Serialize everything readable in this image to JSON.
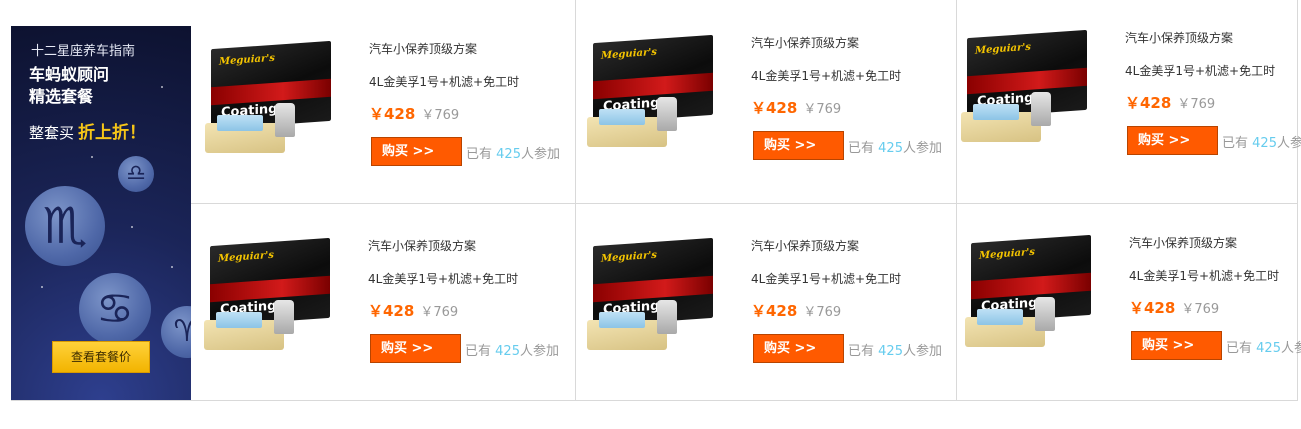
{
  "banner": {
    "subtitle": "十二星座养车指南",
    "title_line1": "车蚂蚁顾问",
    "title_line2": "精选套餐",
    "promo_prefix": "整套买",
    "promo_highlight": "折上折！",
    "button_label": "查看套餐价",
    "zodiac_icons": [
      "libra-icon",
      "scorpio-icon",
      "cancer-icon",
      "aries-icon"
    ]
  },
  "products": [
    {
      "title": "汽车小保养顶级方案",
      "desc": "4L金美孚1号+机滤+免工时",
      "price": "￥428",
      "old_price": "￥769",
      "buy_label": "购买 >>",
      "join_prefix": "已有",
      "join_count": "425",
      "join_suffix": "人参加",
      "image": {
        "brand": "Meguiar's",
        "product_text": "Coating"
      }
    },
    {
      "title": "汽车小保养顶级方案",
      "desc": "4L金美孚1号+机滤+免工时",
      "price": "￥428",
      "old_price": "￥769",
      "buy_label": "购买 >>",
      "join_prefix": "已有",
      "join_count": "425",
      "join_suffix": "人参加",
      "image": {
        "brand": "Meguiar's",
        "product_text": "Coating"
      }
    },
    {
      "title": "汽车小保养顶级方案",
      "desc": "4L金美孚1号+机滤+免工时",
      "price": "￥428",
      "old_price": "￥769",
      "buy_label": "购买 >>",
      "join_prefix": "已有",
      "join_count": "425",
      "join_suffix": "人参加",
      "image": {
        "brand": "Meguiar's",
        "product_text": "Coating"
      }
    },
    {
      "title": "汽车小保养顶级方案",
      "desc": "4L金美孚1号+机滤+免工时",
      "price": "￥428",
      "old_price": "￥769",
      "buy_label": "购买 >>",
      "join_prefix": "已有",
      "join_count": "425",
      "join_suffix": "人参加",
      "image": {
        "brand": "Meguiar's",
        "product_text": "Coating"
      }
    },
    {
      "title": "汽车小保养顶级方案",
      "desc": "4L金美孚1号+机滤+免工时",
      "price": "￥428",
      "old_price": "￥769",
      "buy_label": "购买 >>",
      "join_prefix": "已有",
      "join_count": "425",
      "join_suffix": "人参加",
      "image": {
        "brand": "Meguiar's",
        "product_text": "Coating"
      }
    },
    {
      "title": "汽车小保养顶级方案",
      "desc": "4L金美孚1号+机滤+免工时",
      "price": "￥428",
      "old_price": "￥769",
      "buy_label": "购买 >>",
      "join_prefix": "已有",
      "join_count": "425",
      "join_suffix": "人参加",
      "image": {
        "brand": "Meguiar's",
        "product_text": "Coating"
      }
    }
  ],
  "colors": {
    "price": "#ff6600",
    "buy_button": "#ff5a00",
    "join_count": "#66ccee",
    "banner_button": "#f2b400"
  }
}
